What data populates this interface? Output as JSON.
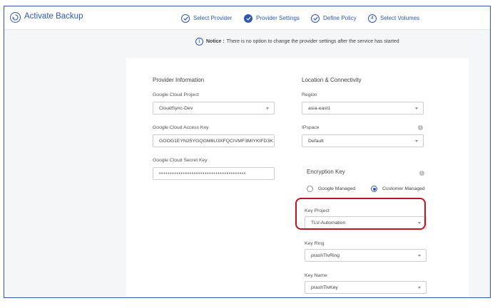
{
  "header": {
    "title": "Activate Backup",
    "steps": [
      {
        "label": "Select Provider",
        "icon": "check",
        "state": "done"
      },
      {
        "label": "Provider Settings",
        "icon": "check",
        "state": "active"
      },
      {
        "label": "Define Policy",
        "icon": "check",
        "state": "done"
      },
      {
        "label": "Select Volumes",
        "icon": "4",
        "state": "pending"
      }
    ]
  },
  "notice": {
    "icon": "i",
    "label": "Notice :",
    "text": "There is no option to change the provider settings after the service has started"
  },
  "provider": {
    "title": "Provider Information",
    "project_label": "Google Cloud Project",
    "project_value": "CloudSync-Dev",
    "access_key_label": "Google Cloud Access Key",
    "access_key_value": "GOOG1EYN25YGQGM6U3XFQCIVMF3MIYKIFD3K",
    "secret_key_label": "Google Cloud Secret Key",
    "secret_key_value": "••••••••••••••••••••••••••••••••••••••••"
  },
  "location": {
    "title": "Location & Connectivity",
    "region_label": "Region",
    "region_value": "asia-east1",
    "ipspace_label": "IPspace",
    "ipspace_value": "Default"
  },
  "encryption": {
    "title": "Encryption Key",
    "option_google": "Google Managed",
    "option_customer": "Customer Managed",
    "selected": "customer",
    "key_project_label": "Key Project",
    "key_project_value": "TLV-Automation",
    "key_ring_label": "Key Ring",
    "key_ring_value": "prashTlvRing",
    "key_name_label": "Key Name",
    "key_name_value": "prashTlvKey"
  },
  "colors": {
    "accent": "#2d57b3",
    "highlight": "#c1151b",
    "background": "#f5f6f8"
  }
}
